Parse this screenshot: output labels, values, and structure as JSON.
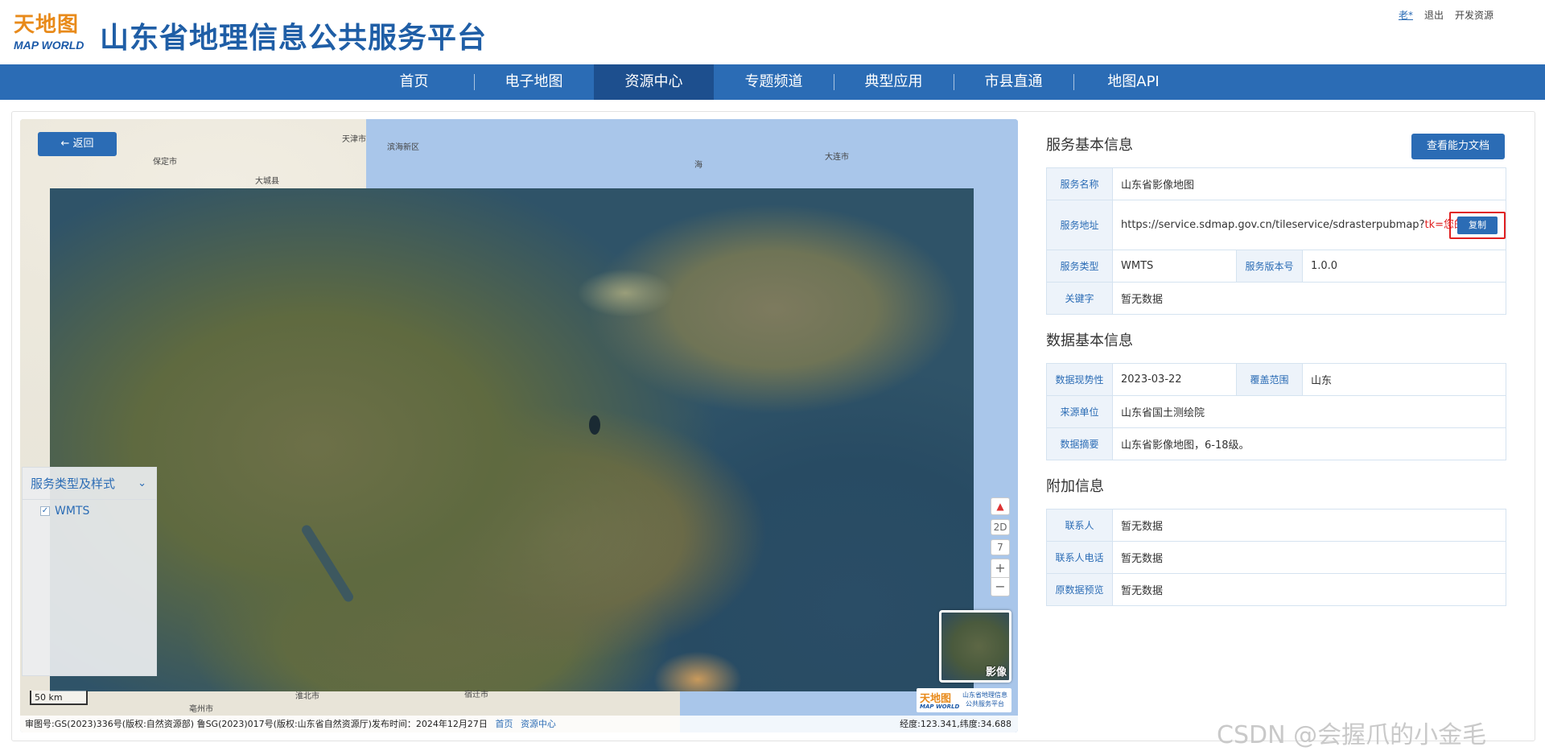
{
  "header": {
    "logo_text": "天地图",
    "logo_sub": "MAP WORLD",
    "site_title": "山东省地理信息公共服务平台",
    "user_link": "老*",
    "logout": "退出",
    "dev_resources": "开发资源"
  },
  "nav": {
    "items": [
      {
        "label": "首页"
      },
      {
        "label": "电子地图"
      },
      {
        "label": "资源中心",
        "active": true
      },
      {
        "label": "专题频道"
      },
      {
        "label": "典型应用"
      },
      {
        "label": "市县直通"
      },
      {
        "label": "地图API"
      }
    ]
  },
  "map": {
    "back_label": "← 返回",
    "labels": {
      "tianjin": "天津市",
      "dalian": "大连市",
      "baoding": "保定市",
      "dazhong": "大城县",
      "binhai": "滨海新区",
      "huaibei": "淮北市",
      "suqian": "宿迁市",
      "bozhou": "亳州市",
      "sea": "海"
    },
    "layer_panel": {
      "title": "服务类型及样式",
      "item": "WMTS",
      "checked": true
    },
    "controls": {
      "compass": "▲",
      "mode": "2D",
      "zoom_level": "7",
      "zoom_in": "+",
      "zoom_out": "−"
    },
    "minimap_label": "影像",
    "badge": {
      "brand": "天地图",
      "brand_sub": "MAP WORLD",
      "line1": "山东省地理信息",
      "line2": "公共服务平台"
    },
    "scale": "50 km",
    "footer": {
      "approval": "审图号:GS(2023)336号(版权:自然资源部) 鲁SG(2023)017号(版权:山东省自然资源厅)发布时间：2024年12月27日",
      "link_home": "首页",
      "link_resources": "资源中心",
      "coords": "经度:123.341,纬度:34.688"
    }
  },
  "info": {
    "service_title": "服务基本信息",
    "doc_button": "查看能力文档",
    "service": {
      "name_key": "服务名称",
      "name_val": "山东省影像地图",
      "url_key": "服务地址",
      "url_val": "https://service.sdmap.gov.cn/tileservice/sdrasterpubmap?",
      "url_red": "tk=您的tk",
      "copy_label": "复制",
      "type_key": "服务类型",
      "type_val": "WMTS",
      "version_key": "服务版本号",
      "version_val": "1.0.0",
      "keyword_key": "关键字",
      "keyword_val": "暂无数据"
    },
    "data_title": "数据基本信息",
    "data": {
      "currency_key": "数据现势性",
      "currency_val": "2023-03-22",
      "coverage_key": "覆盖范围",
      "coverage_val": "山东",
      "source_key": "来源单位",
      "source_val": "山东省国土测绘院",
      "summary_key": "数据摘要",
      "summary_val": "山东省影像地图，6-18级。"
    },
    "extra_title": "附加信息",
    "extra": {
      "contact_key": "联系人",
      "contact_val": "暂无数据",
      "phone_key": "联系人电话",
      "phone_val": "暂无数据",
      "preview_key": "原数据预览",
      "preview_val": "暂无数据"
    }
  },
  "watermark": "CSDN @会握爪的小金毛"
}
